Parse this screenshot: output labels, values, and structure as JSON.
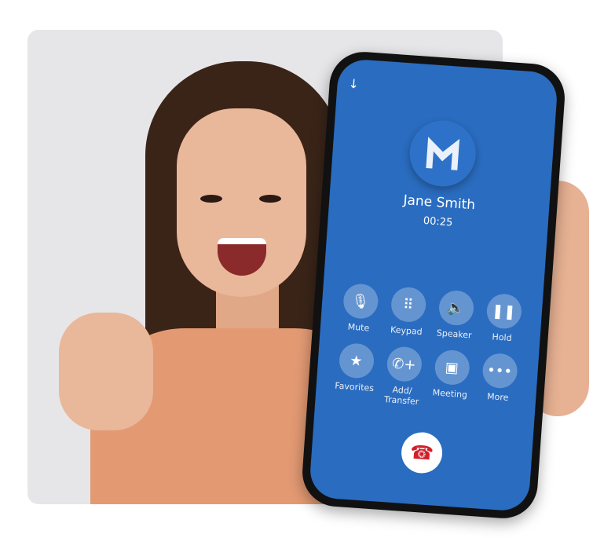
{
  "call": {
    "caller_name": "Jane Smith",
    "duration": "00:25",
    "minimize_icon": "arrow-down-icon",
    "logo": "M brand logo"
  },
  "controls": [
    {
      "label": "Mute",
      "icon": "microphone-icon",
      "glyph": "🎙"
    },
    {
      "label": "Keypad",
      "icon": "keypad-icon",
      "glyph": "⠿"
    },
    {
      "label": "Speaker",
      "icon": "speaker-icon",
      "glyph": "🔈"
    },
    {
      "label": "Hold",
      "icon": "pause-icon",
      "glyph": "❚❚"
    },
    {
      "label": "Favorites",
      "icon": "star-icon",
      "glyph": "★"
    },
    {
      "label": "Add/ Transfer",
      "icon": "add-call-icon",
      "glyph": "✆+"
    },
    {
      "label": "Meeting",
      "icon": "video-icon",
      "glyph": "▣"
    },
    {
      "label": "More",
      "icon": "more-icon",
      "glyph": "•••"
    }
  ],
  "end_call": {
    "icon": "hang-up-icon",
    "glyph": "☎"
  },
  "colors": {
    "screen": "#2a6cc0",
    "end": "#d0202a"
  }
}
